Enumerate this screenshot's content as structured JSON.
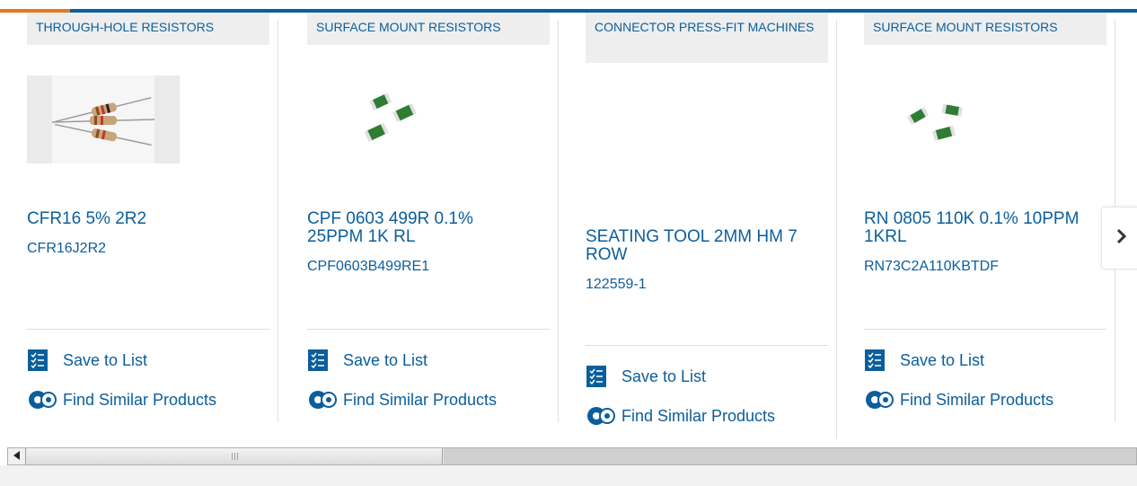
{
  "carousel": {
    "cards": [
      {
        "category": "THROUGH-HOLE RESISTORS",
        "title": "CFR16 5% 2R2",
        "sku": "CFR16J2R2",
        "save_label": "Save to List",
        "similar_label": "Find Similar Products"
      },
      {
        "category": "SURFACE MOUNT RESISTORS",
        "title": "CPF 0603 499R 0.1% 25PPM 1K RL",
        "sku": "CPF0603B499RE1",
        "save_label": "Save to List",
        "similar_label": "Find Similar Products"
      },
      {
        "category": "CONNECTOR PRESS-FIT MACHINES",
        "title": "SEATING TOOL 2MM HM 7 ROW",
        "sku": "122559-1",
        "save_label": "Save to List",
        "similar_label": "Find Similar Products"
      },
      {
        "category": "SURFACE MOUNT RESISTORS",
        "title": "RN 0805 110K 0.1% 10PPM 1KRL",
        "sku": "RN73C2A110KBTDF",
        "save_label": "Save to List",
        "similar_label": "Find Similar Products"
      }
    ],
    "next_icon": "chevron-right-icon"
  },
  "colors": {
    "accent_blue": "#0b5e9c",
    "accent_orange": "#e87722",
    "category_bg": "#eeeeee"
  },
  "icons": {
    "save": "checklist-icon",
    "similar": "gears-icon",
    "scroll_left": "arrow-left-icon"
  }
}
